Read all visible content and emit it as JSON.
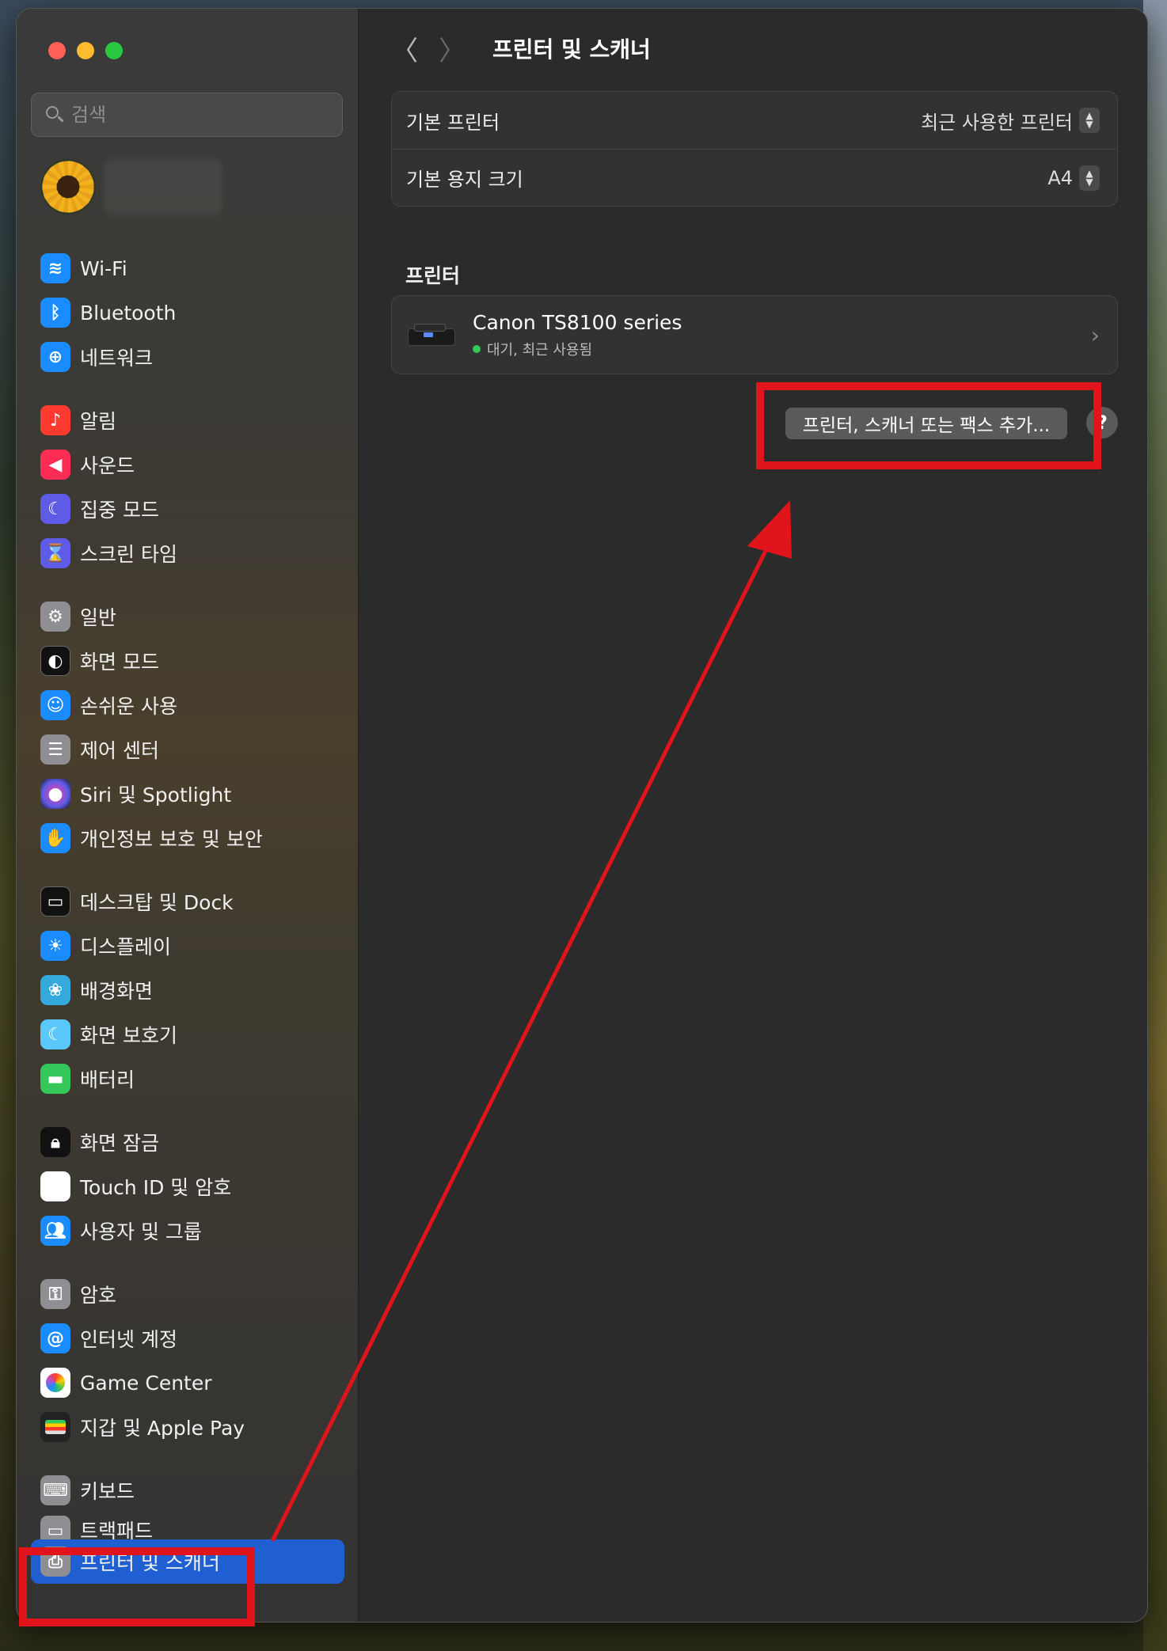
{
  "window": {
    "title": "프린터 및 스캐너"
  },
  "search": {
    "placeholder": "검색"
  },
  "sidebar": {
    "groups": [
      [
        {
          "label": "Wi-Fi",
          "icon": "wifi-icon"
        },
        {
          "label": "Bluetooth",
          "icon": "bluetooth-icon"
        },
        {
          "label": "네트워크",
          "icon": "globe-icon"
        }
      ],
      [
        {
          "label": "알림",
          "icon": "bell-icon"
        },
        {
          "label": "사운드",
          "icon": "speaker-icon"
        },
        {
          "label": "집중 모드",
          "icon": "moon-icon"
        },
        {
          "label": "스크린 타임",
          "icon": "hourglass-icon"
        }
      ],
      [
        {
          "label": "일반",
          "icon": "gear-icon"
        },
        {
          "label": "화면 모드",
          "icon": "appearance-icon"
        },
        {
          "label": "손쉬운 사용",
          "icon": "accessibility-icon"
        },
        {
          "label": "제어 센터",
          "icon": "toggles-icon"
        },
        {
          "label": "Siri 및 Spotlight",
          "icon": "siri-icon"
        },
        {
          "label": "개인정보 보호 및 보안",
          "icon": "hand-icon"
        }
      ],
      [
        {
          "label": "데스크탑 및 Dock",
          "icon": "dock-icon"
        },
        {
          "label": "디스플레이",
          "icon": "sun-icon"
        },
        {
          "label": "배경화면",
          "icon": "flower-icon"
        },
        {
          "label": "화면 보호기",
          "icon": "screensaver-icon"
        },
        {
          "label": "배터리",
          "icon": "battery-icon"
        }
      ],
      [
        {
          "label": "화면 잠금",
          "icon": "lock-icon"
        },
        {
          "label": "Touch ID 및 암호",
          "icon": "fingerprint-icon"
        },
        {
          "label": "사용자 및 그룹",
          "icon": "users-icon"
        }
      ],
      [
        {
          "label": "암호",
          "icon": "key-icon"
        },
        {
          "label": "인터넷 계정",
          "icon": "at-icon"
        },
        {
          "label": "Game Center",
          "icon": "game-center-icon"
        },
        {
          "label": "지갑 및 Apple Pay",
          "icon": "wallet-icon"
        }
      ]
    ],
    "keyboard_label": "키보드",
    "trackpad_label": "트랙패드",
    "active_label": "프린터 및 스캐너"
  },
  "main": {
    "title": "프린터 및 스캐너",
    "default_printer_label": "기본 프린터",
    "default_printer_value": "최근 사용한 프린터",
    "default_paper_label": "기본 용지 크기",
    "default_paper_value": "A4",
    "printers_section": "프린터",
    "printer": {
      "name": "Canon TS8100 series",
      "status": "대기, 최근 사용됨",
      "status_color": "#34c759"
    },
    "add_button": "프린터, 스캐너 또는 팩스 추가...",
    "help_button": "?"
  },
  "colors": {
    "accent": "#1f5fd1",
    "annotation": "#e0141a"
  }
}
